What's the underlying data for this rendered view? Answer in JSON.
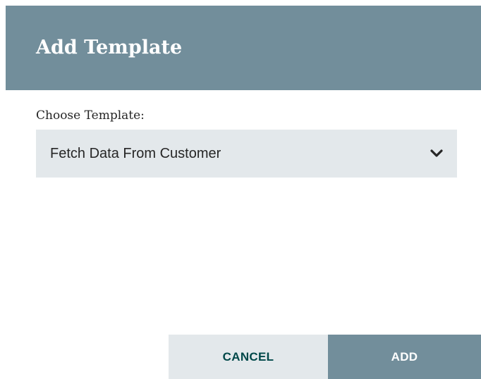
{
  "dialog": {
    "title": "Add Template",
    "field_label": "Choose Template:",
    "template_select": {
      "selected_value": "Fetch Data From Customer",
      "icon": "chevron-down-icon"
    },
    "buttons": {
      "cancel_label": "CANCEL",
      "add_label": "ADD"
    }
  },
  "colors": {
    "header_background": "#728e9b",
    "header_text": "#ffffff",
    "select_background": "#e3e8eb",
    "cancel_background": "#e3e8eb",
    "cancel_text": "#004849",
    "add_background": "#728e9b",
    "add_text": "#ffffff"
  }
}
